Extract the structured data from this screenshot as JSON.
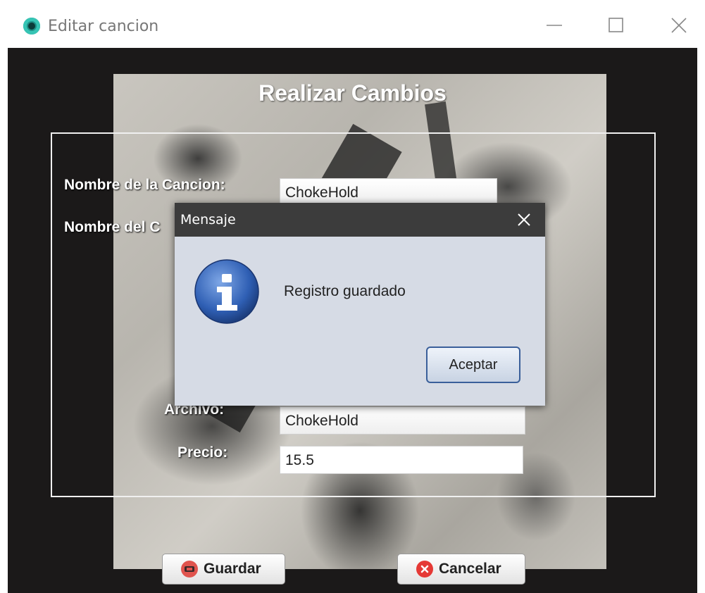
{
  "window": {
    "title": "Editar cancion"
  },
  "form": {
    "title": "Realizar Cambios",
    "labels": {
      "nombre_cancion": "Nombre de la Cancion:",
      "nombre_c_partial": "Nombre del C",
      "archivo": "Archivo:",
      "precio": "Precio:"
    },
    "fields": {
      "nombre_cancion": "ChokeHold",
      "archivo": "ChokeHold",
      "precio": "15.5"
    },
    "buttons": {
      "guardar": "Guardar",
      "cancelar": "Cancelar"
    }
  },
  "dialog": {
    "title": "Mensaje",
    "message": "Registro guardado",
    "ok_label": "Aceptar",
    "icon": "info-icon"
  },
  "colors": {
    "content_bg": "#1b1919",
    "dialog_bg": "#d6dbe5",
    "dialog_titlebar": "#3c3c3c",
    "info_blue": "#2f5fb4"
  }
}
